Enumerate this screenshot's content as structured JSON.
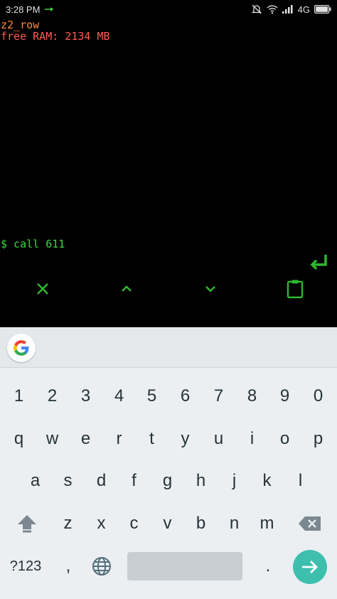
{
  "status_bar": {
    "time": "3:28 PM",
    "network": "4G",
    "icons": [
      "usb-icon",
      "mute-icon",
      "wifi-icon",
      "signal-icon",
      "battery-icon"
    ]
  },
  "terminal": {
    "lines": [
      "z2_row",
      "free RAM: 2134 MB"
    ],
    "prompt_line": "$ call 611",
    "colors": {
      "hostname": "#ff8a3d",
      "ram": "#ff5a4f",
      "prompt": "#3dd63d"
    }
  },
  "actions": [
    "close-icon",
    "chevron-up-icon",
    "chevron-down-icon",
    "clipboard-icon",
    "enter-icon"
  ],
  "keyboard": {
    "number_row": [
      "1",
      "2",
      "3",
      "4",
      "5",
      "6",
      "7",
      "8",
      "9",
      "0"
    ],
    "row1": [
      "q",
      "w",
      "e",
      "r",
      "t",
      "y",
      "u",
      "i",
      "o",
      "p"
    ],
    "row2": [
      "a",
      "s",
      "d",
      "f",
      "g",
      "h",
      "j",
      "k",
      "l"
    ],
    "row3": [
      "z",
      "x",
      "c",
      "v",
      "b",
      "n",
      "m"
    ],
    "symbols_label": "?123",
    "period_label": ".",
    "comma_label": ",",
    "accent_color": "#3ebfae"
  }
}
